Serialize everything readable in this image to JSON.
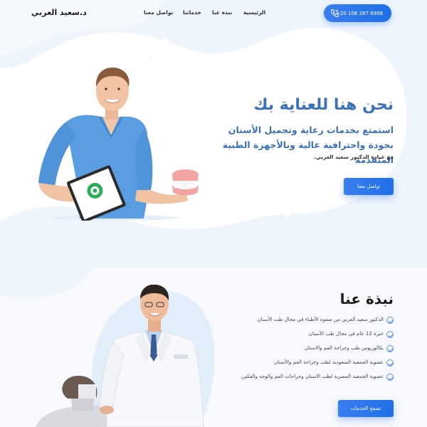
{
  "header": {
    "logo": "د.سعيد العربي",
    "phone": "+20 106 287 8998",
    "nav": [
      {
        "label": "الرئيسية"
      },
      {
        "label": "نبذة عنا"
      },
      {
        "label": "خدماتنا"
      },
      {
        "label": "تواصل معنا"
      }
    ]
  },
  "hero": {
    "title": "نحن هنا للعناية بك",
    "subtitle": "استمتع بخدمات رعاية وتجميل الأسنان بجودة واحترافية عالية وبالأجهزة الطبية المتقدمة",
    "note": "مع عيادة الدكتور سعيد العربي.",
    "button": "تواصل معنا"
  },
  "about": {
    "title": "نبذة عنا",
    "items": [
      "الدكتور سعيد العربي من صفوة الأطباء في مجال طب الأسنان",
      "خبرة 12 عام في مجال طب الأسنان",
      "بكالوريوس طب وجراحة الفم والاسنان",
      "عضوية الجمعية السعودية لطب وجراحة الفم والأسنان",
      "عضوية الجمعية المصرية لطب الاسنان وجراحات الفم والوجه والفكين."
    ],
    "button": "تصفح الخدمات"
  },
  "colors": {
    "accent": "#1f6fe8",
    "heading": "#3a70b8",
    "background": "#eef5fd"
  }
}
